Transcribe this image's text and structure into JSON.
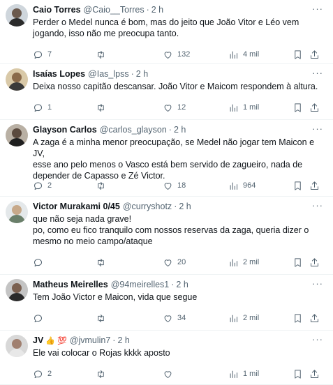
{
  "tweets": [
    {
      "name": "Caio Torres",
      "handle": "@Caio__Torres",
      "dot": "·",
      "time": "2 h",
      "badge": "",
      "text": "Perder o Medel nunca é bom, mas do jeito que João Vitor e Léo vem\njogando, isso não me preocupa tanto.",
      "replies": "7",
      "retweets": "",
      "likes": "132",
      "views": "4 mil",
      "avatar_colors": {
        "bg": "#cfd6dc",
        "face": "#6b5a4e",
        "body": "#2b2b2b"
      }
    },
    {
      "name": "Isaías Lopes",
      "handle": "@Ias_lpss",
      "dot": "·",
      "time": "2 h",
      "badge": "",
      "text": "Deixa nosso capitão descansar. João Vitor e Maicom respondem à altura.",
      "replies": "1",
      "retweets": "",
      "likes": "12",
      "views": "1 mil",
      "avatar_colors": {
        "bg": "#d9c9a8",
        "face": "#8a6a4a",
        "body": "#3a3a3a"
      }
    },
    {
      "name": "Glayson Carlos",
      "handle": "@carlos_glayson",
      "dot": "·",
      "time": "2 h",
      "badge": "",
      "text": "A zaga é a minha menor preocupação, se Medel não jogar tem Maicon e JV,\nesse ano pelo menos o Vasco está bem servido de zagueiro, nada de\ndepender de Capasso e Zé Victor.",
      "replies": "2",
      "retweets": "",
      "likes": "18",
      "views": "964",
      "avatar_colors": {
        "bg": "#b9b0a4",
        "face": "#5b4a3e",
        "body": "#1f1f1f"
      }
    },
    {
      "name": "Victor Murakami 0/45",
      "handle": "@curryshotz",
      "dot": "·",
      "time": "2 h",
      "badge": "",
      "text": "que não seja nada grave!\npo, como eu fico tranquilo com nossos reservas da zaga, queria dizer o\nmesmo no meio campo/ataque",
      "replies": "",
      "retweets": "",
      "likes": "20",
      "views": "2 mil",
      "avatar_colors": {
        "bg": "#e4e8ea",
        "face": "#c7a98a",
        "body": "#6a7f6a"
      }
    },
    {
      "name": "Matheus Meirelles",
      "handle": "@94meirelles1",
      "dot": "·",
      "time": "2 h",
      "badge": "",
      "text": "Tem João Victor e Maicon, vida que segue",
      "replies": "",
      "retweets": "",
      "likes": "34",
      "views": "2 mil",
      "avatar_colors": {
        "bg": "#c4c4c4",
        "face": "#7a6050",
        "body": "#2a2a2a"
      }
    },
    {
      "name": "JV",
      "handle": "@jvmulin7",
      "dot": "·",
      "time": "2 h",
      "badge": "👍 💯",
      "text": "Ele vai colocar o Rojas kkkk aposto",
      "replies": "2",
      "retweets": "",
      "likes": "",
      "views": "1 mil",
      "avatar_colors": {
        "bg": "#d8d8d8",
        "face": "#a08070",
        "body": "#e8e8e8"
      }
    }
  ],
  "icons": {
    "reply": "reply-icon",
    "retweet": "retweet-icon",
    "like": "heart-icon",
    "views": "views-icon",
    "bookmark": "bookmark-icon",
    "share": "share-icon",
    "more": "more-icon"
  },
  "more_label": "···"
}
